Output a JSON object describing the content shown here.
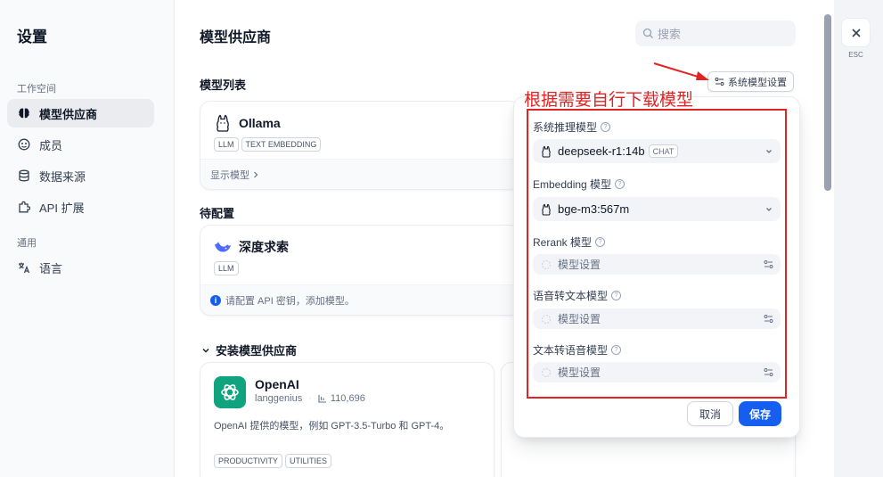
{
  "sidebar": {
    "title": "设置",
    "workspace_group": "工作空间",
    "general_group": "通用",
    "items": [
      {
        "label": "模型供应商",
        "icon": "brain-icon"
      },
      {
        "label": "成员",
        "icon": "members-icon"
      },
      {
        "label": "数据来源",
        "icon": "database-icon"
      },
      {
        "label": "API 扩展",
        "icon": "puzzle-icon"
      },
      {
        "label": "语言",
        "icon": "translate-icon"
      }
    ]
  },
  "header": {
    "title": "模型供应商",
    "search_placeholder": "搜索"
  },
  "model_list": {
    "title": "模型列表",
    "system_settings_button": "系统模型设置",
    "ollama": {
      "name": "Ollama",
      "tags": [
        "LLM",
        "TEXT EMBEDDING"
      ],
      "show_models": "显示模型"
    }
  },
  "pending": {
    "title": "待配置",
    "deepseek": {
      "name": "深度求索",
      "tags": [
        "LLM"
      ],
      "notice": "请配置 API 密钥，添加模型。"
    }
  },
  "install": {
    "title": "安装模型供应商",
    "openai": {
      "name": "OpenAI",
      "author": "langgenius",
      "separator": "·",
      "installs": "110,696",
      "description": "OpenAI 提供的模型，例如 GPT-3.5-Turbo 和 GPT-4。",
      "tags": [
        "PRODUCTIVITY",
        "UTILITIES"
      ]
    }
  },
  "popover": {
    "fields": [
      {
        "label": "系统推理模型",
        "value": "deepseek-r1:14b",
        "badge": "CHAT"
      },
      {
        "label": "Embedding 模型",
        "value": "bge-m3:567m"
      },
      {
        "label": "Rerank 模型",
        "placeholder": "模型设置"
      },
      {
        "label": "语音转文本模型",
        "placeholder": "模型设置"
      },
      {
        "label": "文本转语音模型",
        "placeholder": "模型设置"
      }
    ],
    "cancel": "取消",
    "save": "保存"
  },
  "close": {
    "label": "ESC"
  },
  "annotation": {
    "text": "根据需要自行下载模型",
    "color": "#e02424"
  }
}
